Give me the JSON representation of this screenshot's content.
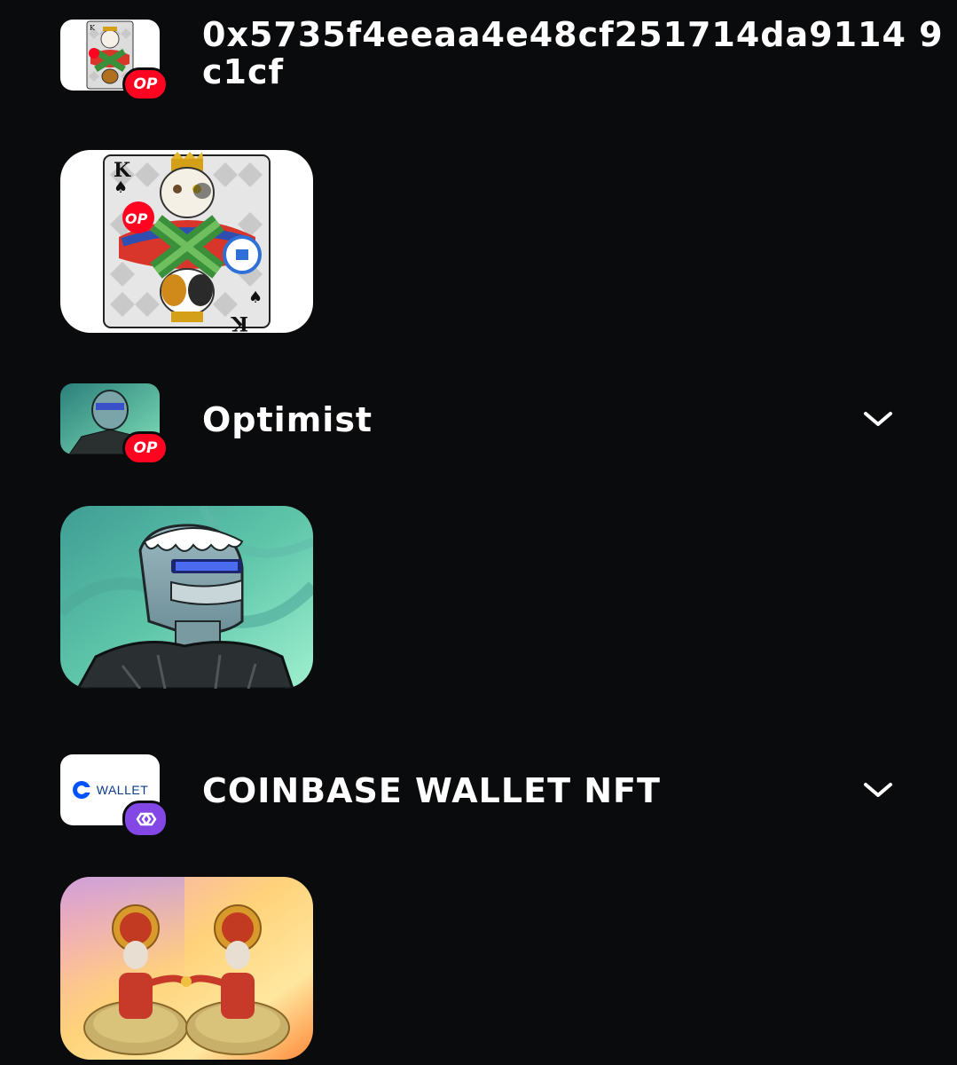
{
  "collections": [
    {
      "name": "0x5735f4eeaa4e48cf251714da9114 9c1cf",
      "chain_badge": "OP",
      "thumb_icon": "king-cat-card-icon",
      "nft_icon": "king-cat-card-art"
    },
    {
      "name": "Optimist",
      "chain_badge": "OP",
      "thumb_icon": "optimist-avatar-icon",
      "nft_icon": "optimist-avatar-art"
    },
    {
      "name": "COINBASE WALLET NFT",
      "chain_badge": "",
      "thumb_label": "WALLET",
      "thumb_icon": "coinbase-wallet-logo",
      "badge_icon": "polygon-chain-icon",
      "nft_icon": "kathakali-dancers-art"
    }
  ],
  "colors": {
    "background": "#0a0b0d",
    "op_red": "#ff0420",
    "polygon_purple": "#8247e5",
    "coinbase_blue": "#0052ff"
  }
}
